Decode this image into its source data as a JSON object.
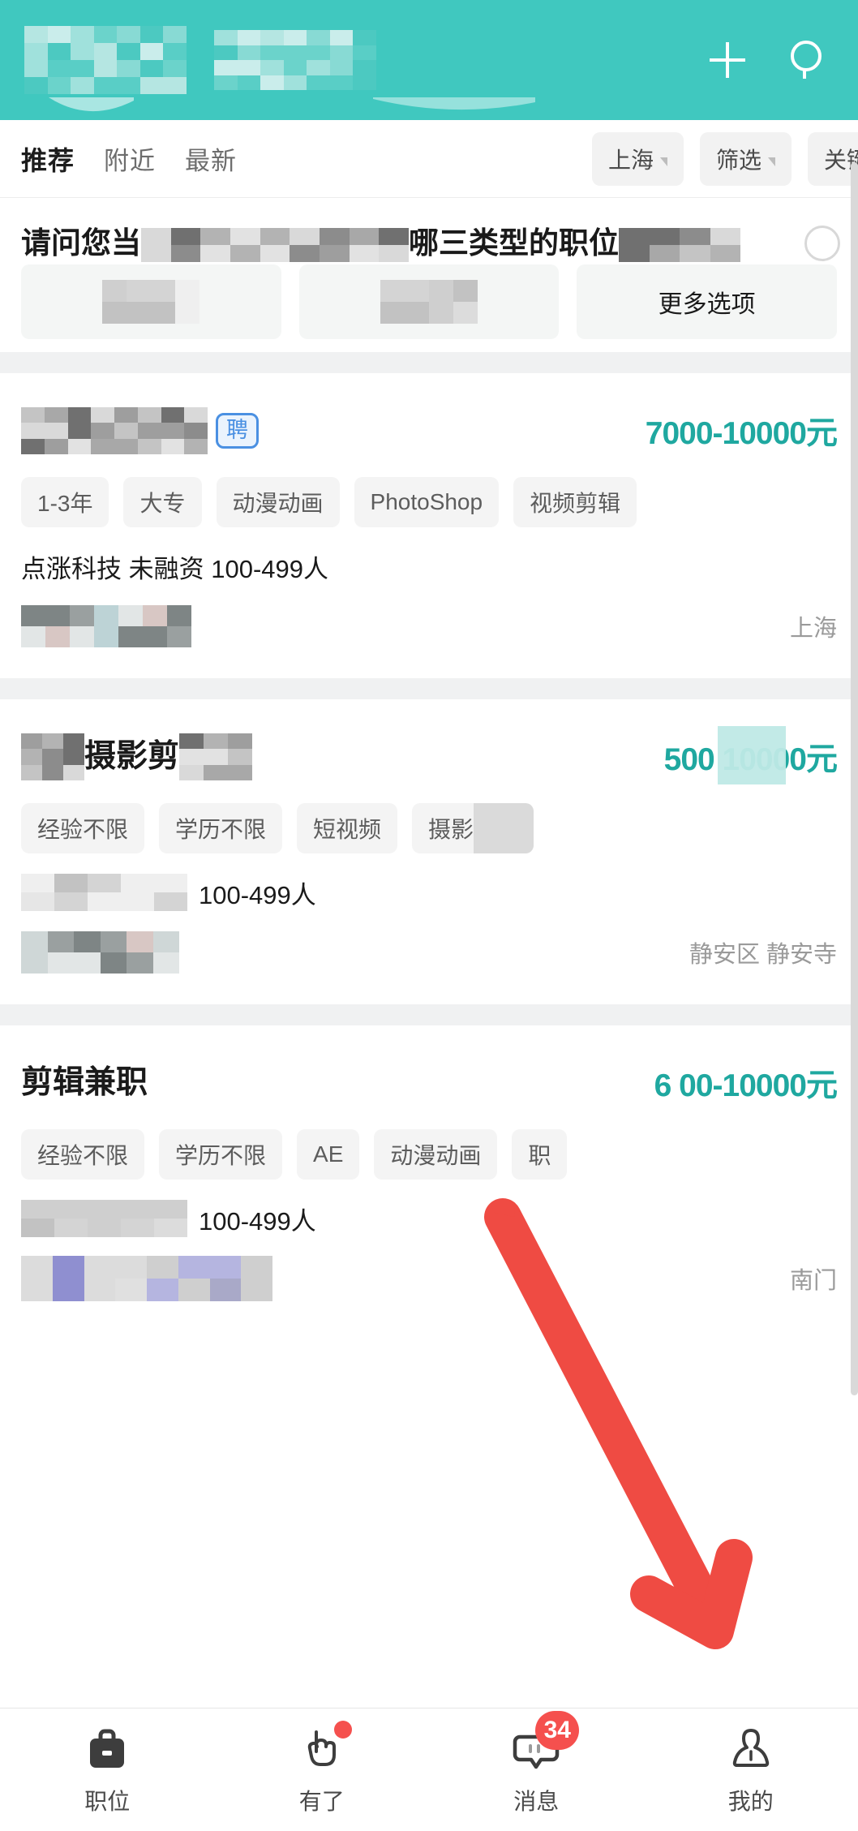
{
  "header": {
    "background_color": "#40c8bf",
    "logo_redacted": true,
    "title_redacted": true,
    "actions": [
      {
        "name": "plus-icon",
        "label": "+"
      },
      {
        "name": "search-icon",
        "label": "search"
      }
    ]
  },
  "tabs": [
    {
      "label": "推荐",
      "active": true
    },
    {
      "label": "附近",
      "active": false
    },
    {
      "label": "最新",
      "active": false
    }
  ],
  "filters": [
    {
      "label": "上海",
      "has_caret": true
    },
    {
      "label": "筛选",
      "has_caret": true
    },
    {
      "label": "关键",
      "has_caret": false,
      "cut_off": true
    }
  ],
  "survey": {
    "question_visible_prefix": "请问您当",
    "question_visible_mid": "哪三类型的职位",
    "question_tail": "?",
    "close_icon": "close-circle-icon",
    "options": [
      {
        "label": "",
        "redacted": true
      },
      {
        "label": "",
        "redacted": true
      },
      {
        "label": "更多选项",
        "redacted": false
      }
    ]
  },
  "jobs": [
    {
      "title": "",
      "title_redacted": true,
      "badge": "聘",
      "salary": "7000-10000元",
      "tags": [
        "1-3年",
        "大专",
        "动漫动画",
        "PhotoShop",
        "视频剪辑"
      ],
      "company": "点涨科技 未融资 100-499人",
      "company_redacted": false,
      "avatar_redacted": true,
      "location": "上海"
    },
    {
      "title": "摄影剪",
      "title_redacted": true,
      "badge": "",
      "salary": "500 10000元",
      "salary_partial": true,
      "tags": [
        "经验不限",
        "学历不限",
        "短视频",
        "摄影"
      ],
      "tags_last_redacted": true,
      "company": "100-499人",
      "company_redacted": true,
      "avatar_redacted": true,
      "location": "静安区 静安寺"
    },
    {
      "title": "剪辑兼职",
      "title_redacted": false,
      "badge": "",
      "salary": "6 00-10000元",
      "salary_partial": true,
      "tags": [
        "经验不限",
        "学历不限",
        "AE",
        "动漫动画",
        "职"
      ],
      "tags_last_redacted": true,
      "company": "100-499人",
      "company_redacted": true,
      "avatar_redacted": true,
      "location": "南门"
    }
  ],
  "arrow": {
    "name": "red-pointer-arrow",
    "color": "#ef4b43",
    "points_to": "我的"
  },
  "bottom_nav": [
    {
      "label": "职位",
      "icon": "briefcase-icon",
      "active": false,
      "badge": "",
      "dot": false
    },
    {
      "label": "有了",
      "icon": "hand-tap-icon",
      "active": false,
      "badge": "",
      "dot": true
    },
    {
      "label": "消息",
      "icon": "chat-bubble-icon",
      "active": false,
      "badge": "34",
      "dot": false
    },
    {
      "label": "我的",
      "icon": "person-icon",
      "active": false,
      "badge": "",
      "dot": false
    }
  ],
  "colors": {
    "teal_header": "#40c8bf",
    "teal_salary": "#1fa8a0",
    "red_badge": "#f5504e",
    "red_arrow": "#ef4b43",
    "chip_bg": "#f2f2f2",
    "text_dark": "#1a1a1a",
    "text_muted": "#9a9a9a"
  }
}
